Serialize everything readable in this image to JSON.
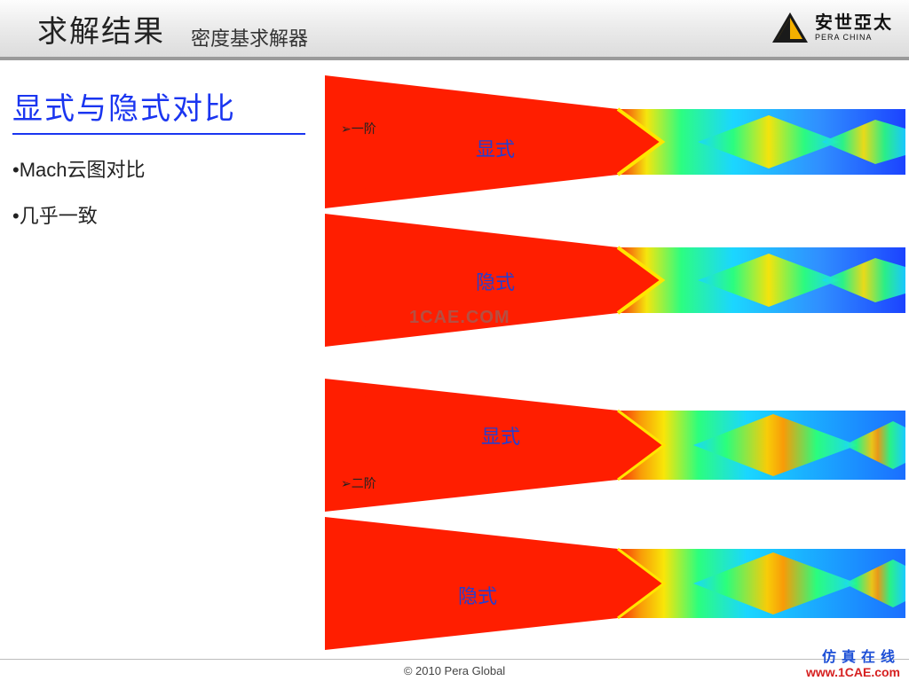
{
  "header": {
    "title": "求解结果",
    "subtitle": "密度基求解器",
    "logo_text": "安世亞太",
    "logo_sub": "PERA CHINA"
  },
  "left": {
    "heading": "显式与隐式对比",
    "bullets": [
      "•Mach云图对比",
      "•几乎一致"
    ]
  },
  "annotations": {
    "order1": "➢一阶",
    "order2": "➢二阶",
    "explicit": "显式",
    "implicit": "隐式"
  },
  "watermark": "1CAE.COM",
  "footer": {
    "copyright": "© 2010 Pera Global",
    "corner_cn": "仿真在线",
    "corner_url": "www.1CAE.com"
  }
}
